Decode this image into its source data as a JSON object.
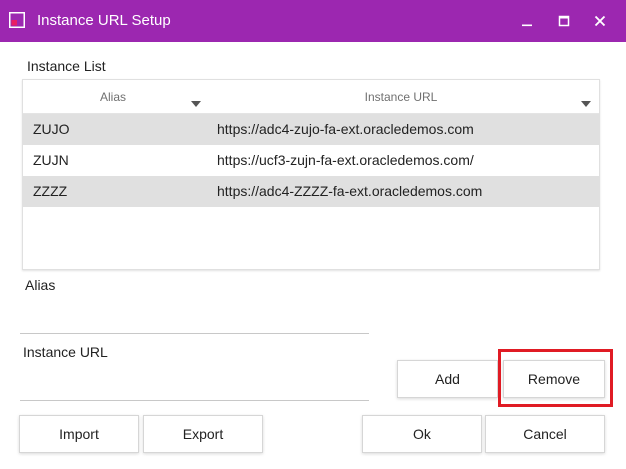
{
  "window": {
    "title": "Instance URL Setup",
    "icon": "app-window-icon",
    "accent_color": "#9c27b0",
    "controls": [
      "minimize-icon",
      "maximize-icon",
      "close-icon"
    ]
  },
  "instance_list": {
    "label": "Instance List",
    "columns": [
      {
        "header": "Alias",
        "sort_icon": "caret-down-icon"
      },
      {
        "header": "Instance URL",
        "sort_icon": "caret-down-icon"
      }
    ],
    "rows": [
      {
        "alias": "ZUJO",
        "url": "https://adc4-zujo-fa-ext.oracledemos.com",
        "selected": true
      },
      {
        "alias": "ZUJN",
        "url": "https://ucf3-zujn-fa-ext.oracledemos.com/",
        "selected": false
      },
      {
        "alias": "ZZZZ",
        "url": "https://adc4-ZZZZ-fa-ext.oracledemos.com",
        "selected": false
      }
    ]
  },
  "form": {
    "alias_label": "Alias",
    "alias_value": "",
    "url_label": "Instance URL",
    "url_value": ""
  },
  "buttons": {
    "add": "Add",
    "remove": "Remove",
    "import": "Import",
    "export": "Export",
    "ok": "Ok",
    "cancel": "Cancel"
  },
  "highlight_color": "#e01b24"
}
